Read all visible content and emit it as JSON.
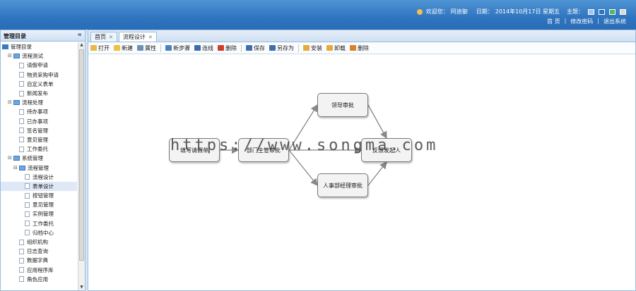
{
  "header": {
    "welcome": "欢迎您：",
    "username": "阿迪御",
    "date_label": "日期：",
    "date_value": "2014年10月17日 星期五",
    "theme_label": "主题：",
    "theme_colors": [
      "#9fc5ea",
      "#2f74bf",
      "#55b85a",
      "#d9d9d9"
    ],
    "links": [
      "首 页",
      "修改密码",
      "退出系统"
    ]
  },
  "sidebar": {
    "title": "管理目录",
    "root": "管理目录",
    "items": [
      {
        "label": "流程测试",
        "level": 1,
        "type": "folder"
      },
      {
        "label": "请假申请",
        "level": 2,
        "type": "page"
      },
      {
        "label": "物资采购申请",
        "level": 2,
        "type": "page"
      },
      {
        "label": "自定义表单",
        "level": 2,
        "type": "page"
      },
      {
        "label": "新闻发布",
        "level": 2,
        "type": "page"
      },
      {
        "label": "流程处理",
        "level": 1,
        "type": "folder"
      },
      {
        "label": "待办事项",
        "level": 2,
        "type": "page"
      },
      {
        "label": "已办事项",
        "level": 2,
        "type": "page"
      },
      {
        "label": "签名管理",
        "level": 2,
        "type": "page"
      },
      {
        "label": "意见管理",
        "level": 2,
        "type": "page"
      },
      {
        "label": "工作委托",
        "level": 2,
        "type": "page"
      },
      {
        "label": "系统管理",
        "level": 1,
        "type": "folder"
      },
      {
        "label": "流程管理",
        "level": 2,
        "type": "folder"
      },
      {
        "label": "流程设计",
        "level": 3,
        "type": "page"
      },
      {
        "label": "表单设计",
        "level": 3,
        "type": "page",
        "selected": true
      },
      {
        "label": "按钮管理",
        "level": 3,
        "type": "page"
      },
      {
        "label": "意见管理",
        "level": 3,
        "type": "page"
      },
      {
        "label": "实例管理",
        "level": 3,
        "type": "page"
      },
      {
        "label": "工作委托",
        "level": 3,
        "type": "page"
      },
      {
        "label": "归档中心",
        "level": 3,
        "type": "page"
      },
      {
        "label": "组织机构",
        "level": 2,
        "type": "page"
      },
      {
        "label": "日志查询",
        "level": 2,
        "type": "page"
      },
      {
        "label": "数据字典",
        "level": 2,
        "type": "page"
      },
      {
        "label": "应用程序库",
        "level": 2,
        "type": "page"
      },
      {
        "label": "角色应用",
        "level": 2,
        "type": "page"
      }
    ]
  },
  "tabs": [
    {
      "label": "首页",
      "active": false
    },
    {
      "label": "流程设计",
      "active": true
    }
  ],
  "toolbar": [
    {
      "label": "打开",
      "icon": "folder-open-icon",
      "color": "#e8b84a"
    },
    {
      "label": "新建",
      "icon": "new-icon",
      "color": "#f0c040"
    },
    {
      "label": "属性",
      "icon": "properties-icon",
      "color": "#6b8fb5"
    },
    {
      "sep": true
    },
    {
      "label": "新步骤",
      "icon": "step-icon",
      "color": "#4a7fc0"
    },
    {
      "label": "连线",
      "icon": "line-icon",
      "color": "#3b6ea8"
    },
    {
      "label": "删除",
      "icon": "delete-icon",
      "color": "#d23a2a"
    },
    {
      "sep": true
    },
    {
      "label": "保存",
      "icon": "save-icon",
      "color": "#3d6fb0"
    },
    {
      "label": "另存为",
      "icon": "save-as-icon",
      "color": "#3d6fb0"
    },
    {
      "sep": true
    },
    {
      "label": "安装",
      "icon": "install-icon",
      "color": "#e8a83a"
    },
    {
      "label": "卸载",
      "icon": "uninstall-icon",
      "color": "#e8a83a"
    },
    {
      "label": "删除",
      "icon": "delete-flow-icon",
      "color": "#d9822b"
    }
  ],
  "flow": {
    "nodes": [
      {
        "id": "n1",
        "label": "填写请假单"
      },
      {
        "id": "n2",
        "label": "部门主管审批"
      },
      {
        "id": "n3",
        "label": "领导审批"
      },
      {
        "id": "n4",
        "label": "人事部经理审批"
      },
      {
        "id": "n5",
        "label": "反馈发起人"
      }
    ],
    "edges": [
      [
        "n1",
        "n2"
      ],
      [
        "n2",
        "n3"
      ],
      [
        "n2",
        "n4"
      ],
      [
        "n2",
        "n5"
      ],
      [
        "n3",
        "n5"
      ],
      [
        "n4",
        "n5"
      ]
    ]
  },
  "watermark": "https://www.songma.com"
}
